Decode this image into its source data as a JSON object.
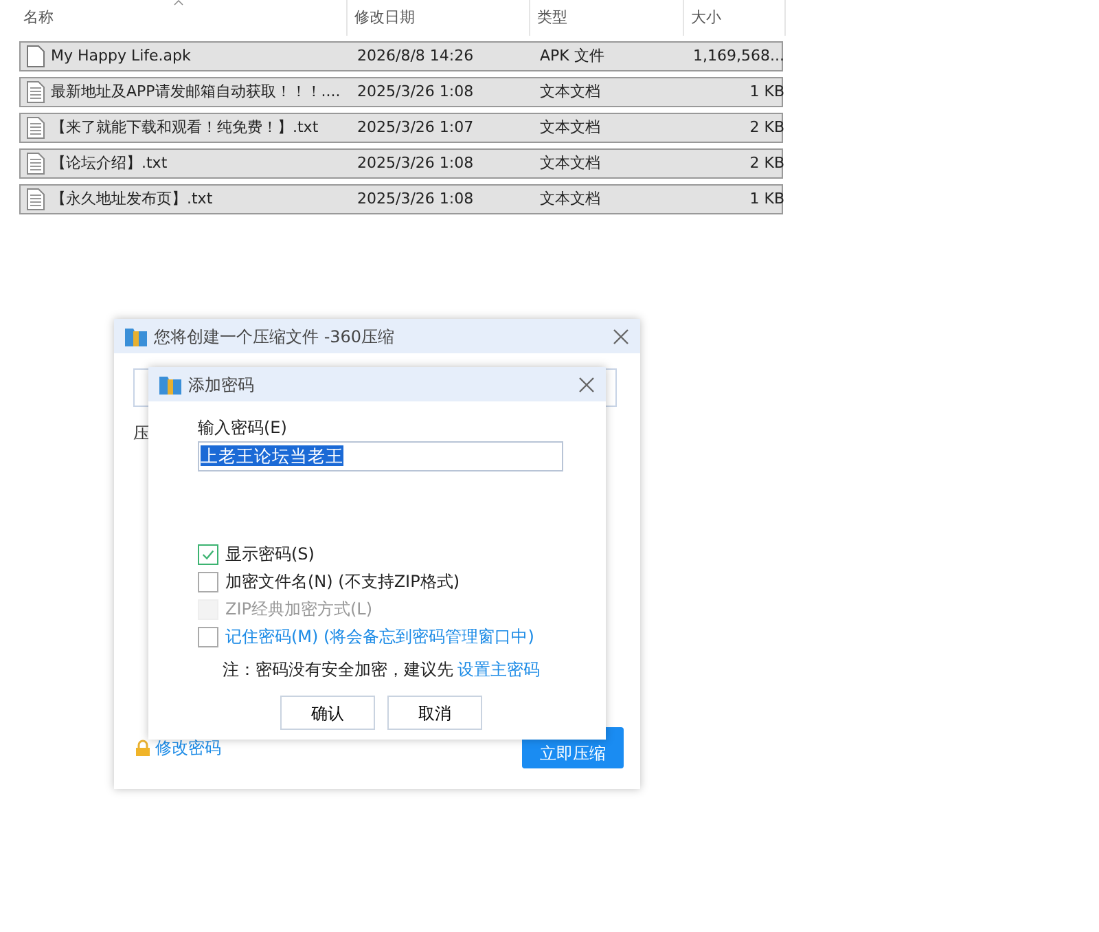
{
  "file_list": {
    "columns": [
      {
        "label": "名称",
        "sorted": true
      },
      {
        "label": "修改日期",
        "sorted": false
      },
      {
        "label": "类型",
        "sorted": false
      },
      {
        "label": "大小",
        "sorted": false
      }
    ],
    "rows": [
      {
        "name": "My Happy Life.apk",
        "date": "2026/8/8 14:26",
        "type": "APK 文件",
        "size": "1,169,568...",
        "kind": "apk",
        "selected": true
      },
      {
        "name": "最新地址及APP请发邮箱自动获取！！！....",
        "date": "2025/3/26 1:08",
        "type": "文本文档",
        "size": "1 KB",
        "kind": "txt",
        "selected": true
      },
      {
        "name": "【来了就能下载和观看！纯免费！】.txt",
        "date": "2025/3/26 1:07",
        "type": "文本文档",
        "size": "2 KB",
        "kind": "txt",
        "selected": true
      },
      {
        "name": "【论坛介绍】.txt",
        "date": "2025/3/26 1:08",
        "type": "文本文档",
        "size": "2 KB",
        "kind": "txt",
        "selected": true
      },
      {
        "name": "【永久地址发布页】.txt",
        "date": "2025/3/26 1:08",
        "type": "文本文档",
        "size": "1 KB",
        "kind": "txt",
        "selected": true
      }
    ]
  },
  "compress_dialog": {
    "title": "您将创建一个压缩文件 -360压缩",
    "label": "压",
    "change_password_link": "修改密码",
    "compress_button": "立即压缩"
  },
  "password_dialog": {
    "title": "添加密码",
    "password_label": "输入密码(E)",
    "password_value": "上老王论坛当老王",
    "value_selected": true,
    "options": [
      {
        "label": "显示密码(S)",
        "checked": true,
        "disabled": false,
        "kind": "plain"
      },
      {
        "label": "加密文件名(N) (不支持ZIP格式)",
        "checked": false,
        "disabled": false,
        "kind": "plain"
      },
      {
        "label": "ZIP经典加密方式(L)",
        "checked": false,
        "disabled": true,
        "kind": "plain"
      },
      {
        "label": "记住密码(M) (将会备忘到密码管理窗口中)",
        "checked": false,
        "disabled": false,
        "kind": "link"
      }
    ],
    "note": "注：密码没有安全加密，建议先",
    "note_link": "设置主密码",
    "buttons": [
      "确认",
      "取消"
    ]
  }
}
